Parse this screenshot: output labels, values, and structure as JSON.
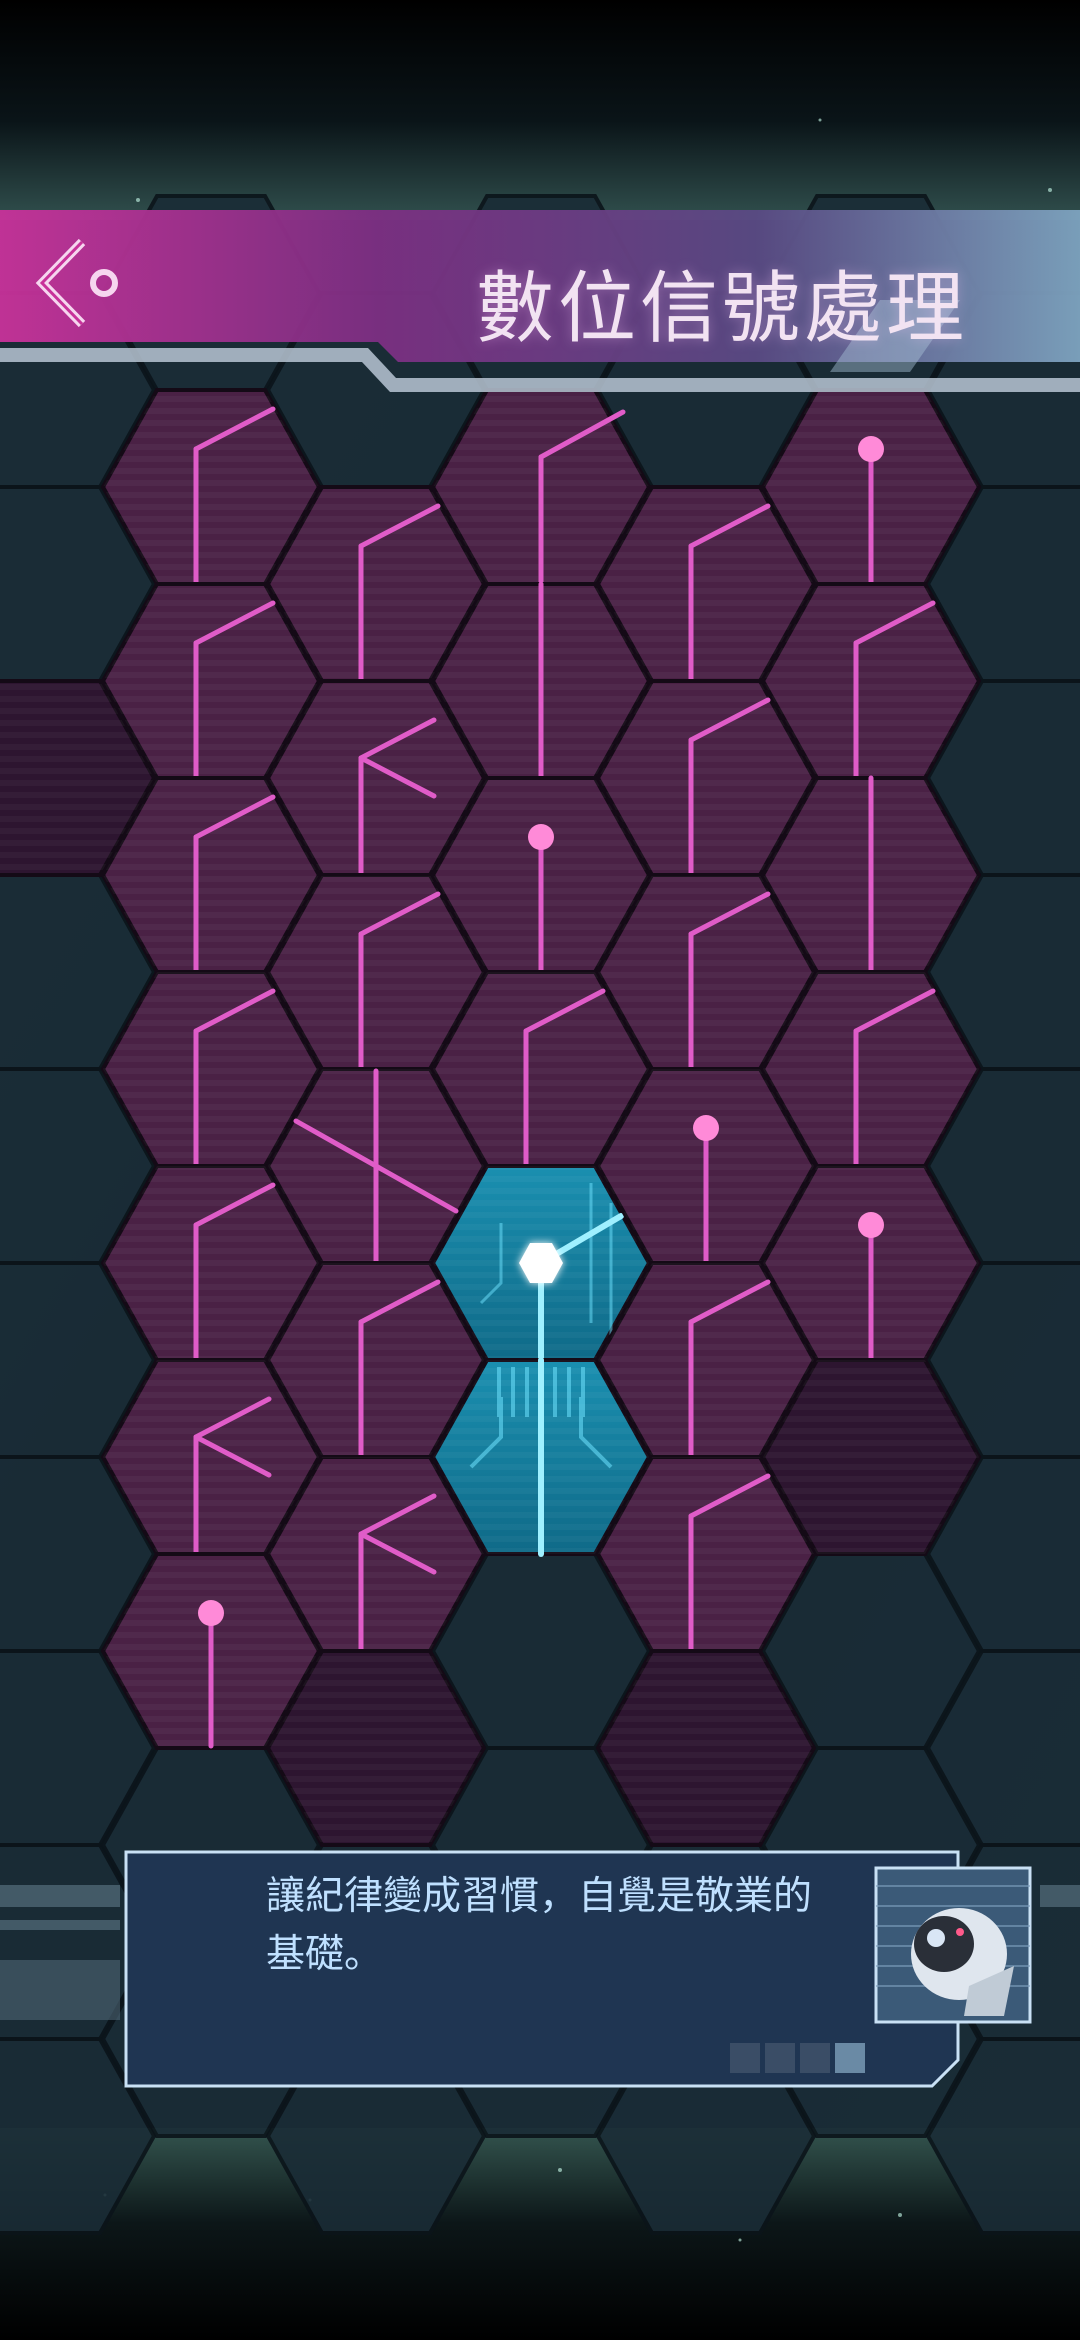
{
  "header": {
    "title": "數位信號處理",
    "back_icon": "back-chevron-icon"
  },
  "dialog": {
    "text": "讓紀律變成習慣，自覺是敬業的基礎。",
    "page_count": 4,
    "current_page": 4,
    "portrait_icon": "robot-portrait-icon"
  },
  "colors": {
    "tile_magenta": "#4a2145",
    "tile_dark": "#2d1530",
    "tile_active": "#1a8fb0",
    "line_pink": "#e05cc8",
    "dot_pink": "#ff8ad8",
    "header_pink": "#c8329a",
    "beam_cyan": "#9ff0ff",
    "background_hex": "#1a2c36"
  },
  "board": {
    "tiles": [
      {
        "col": 0,
        "row": 1,
        "type": "dark"
      },
      {
        "col": 1,
        "row": 0,
        "type": "pipe",
        "shape": "bend"
      },
      {
        "col": 1,
        "row": 1,
        "type": "pipe",
        "shape": "bend"
      },
      {
        "col": 1,
        "row": 2,
        "type": "pipe",
        "shape": "bend"
      },
      {
        "col": 1,
        "row": 3,
        "type": "pipe",
        "shape": "bend"
      },
      {
        "col": 1,
        "row": 4,
        "type": "pipe",
        "shape": "bend"
      },
      {
        "col": 1,
        "row": 5,
        "type": "pipe",
        "shape": "fork"
      },
      {
        "col": 1,
        "row": 6,
        "type": "source"
      },
      {
        "col": 2,
        "row": 0,
        "type": "pipe",
        "shape": "bend"
      },
      {
        "col": 2,
        "row": 1,
        "type": "pipe",
        "shape": "fork"
      },
      {
        "col": 2,
        "row": 2,
        "type": "pipe",
        "shape": "bend"
      },
      {
        "col": 2,
        "row": 3,
        "type": "pipe",
        "shape": "cross"
      },
      {
        "col": 2,
        "row": 4,
        "type": "pipe",
        "shape": "bend"
      },
      {
        "col": 2,
        "row": 5,
        "type": "pipe",
        "shape": "fork"
      },
      {
        "col": 2,
        "row": 6,
        "type": "dark"
      },
      {
        "col": 3,
        "row": 0,
        "type": "pipe",
        "shape": "long"
      },
      {
        "col": 3,
        "row": 1,
        "type": "pipe",
        "shape": "straight"
      },
      {
        "col": 3,
        "row": 2,
        "type": "source"
      },
      {
        "col": 3,
        "row": 3,
        "type": "pipe",
        "shape": "bend"
      },
      {
        "col": 3,
        "row": 4,
        "type": "active-core"
      },
      {
        "col": 3,
        "row": 5,
        "type": "active-pipe"
      },
      {
        "col": 4,
        "row": 0,
        "type": "pipe",
        "shape": "bend"
      },
      {
        "col": 4,
        "row": 1,
        "type": "pipe",
        "shape": "bend"
      },
      {
        "col": 4,
        "row": 2,
        "type": "pipe",
        "shape": "bend"
      },
      {
        "col": 4,
        "row": 3,
        "type": "source"
      },
      {
        "col": 4,
        "row": 4,
        "type": "pipe",
        "shape": "bend"
      },
      {
        "col": 4,
        "row": 5,
        "type": "pipe",
        "shape": "bend"
      },
      {
        "col": 4,
        "row": 6,
        "type": "dark"
      },
      {
        "col": 5,
        "row": 0,
        "type": "source"
      },
      {
        "col": 5,
        "row": 1,
        "type": "pipe",
        "shape": "bend"
      },
      {
        "col": 5,
        "row": 2,
        "type": "pipe",
        "shape": "straight"
      },
      {
        "col": 5,
        "row": 3,
        "type": "pipe",
        "shape": "bend"
      },
      {
        "col": 5,
        "row": 4,
        "type": "source"
      },
      {
        "col": 5,
        "row": 5,
        "type": "dark"
      }
    ]
  }
}
